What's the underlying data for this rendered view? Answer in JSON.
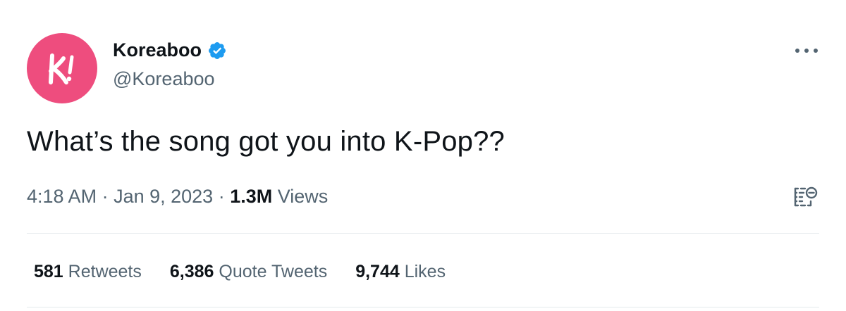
{
  "author": {
    "display_name": "Koreaboo",
    "handle": "@Koreaboo",
    "verified": true,
    "avatar_color": "#ee4d7e",
    "avatar_icon": "koreaboo-k-logo-icon"
  },
  "tweet": {
    "text": "What’s the song got you into K-Pop??"
  },
  "meta": {
    "time": "4:18 AM",
    "separator": " · ",
    "date": "Jan 9, 2023",
    "views_count": "1.3M",
    "views_label": " Views"
  },
  "stats": {
    "retweets_count": "581",
    "retweets_label": " Retweets",
    "quotes_count": "6,386",
    "quotes_label": " Quote Tweets",
    "likes_count": "9,744",
    "likes_label": " Likes"
  },
  "colors": {
    "verified_blue": "#1d9bf0",
    "secondary_text": "#536471",
    "primary_text": "#0f1419",
    "divider": "#e4e9ed"
  },
  "icons": {
    "more": "more-horizontal-icon",
    "analytics": "tweet-analytics-icon",
    "verified": "verified-badge-icon"
  }
}
